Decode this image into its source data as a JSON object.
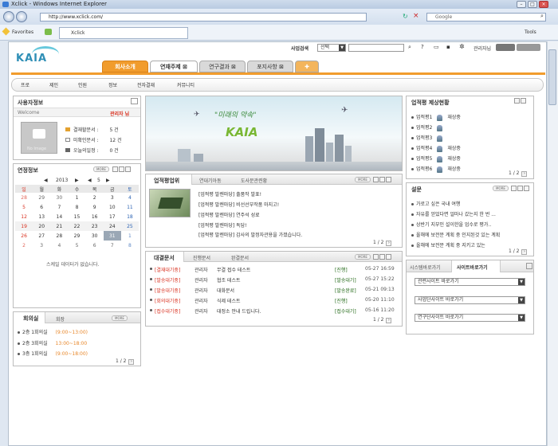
{
  "browser": {
    "window_title": "Xclick - Windows Internet Explorer",
    "address": "http://www.xclick.com/",
    "search_placeholder": "Google",
    "favorites_label": "Favorites",
    "tab_label": "Xclick",
    "tools_label": "Tools"
  },
  "header": {
    "logo": "KAIA",
    "search_label": "사업검색",
    "search_select": "선택",
    "user_label": "관리자님",
    "main_tabs": [
      "회사소개",
      "연재주제",
      "연구결과",
      "포지사항"
    ],
    "sub_menu": [
      "프로",
      "제인",
      "인원",
      "정보",
      "전자결재",
      "커뮤니티"
    ]
  },
  "user_panel": {
    "title": "사용자정보",
    "welcome": "Welcome",
    "user_name": "관리자 님",
    "no_image": "No Image",
    "stats": [
      {
        "label": "결재할문서 :",
        "value": "5 건"
      },
      {
        "label": "미확인문서 :",
        "value": "12 건"
      },
      {
        "label": "오늘의일정 :",
        "value": "0 건"
      }
    ]
  },
  "calendar": {
    "title": "연정정보",
    "more": "MORE",
    "year": "2013",
    "month": "5",
    "weekdays": [
      "일",
      "월",
      "화",
      "수",
      "목",
      "금",
      "토"
    ],
    "weeks": [
      [
        "28",
        "29",
        "30",
        "1",
        "2",
        "3",
        "4"
      ],
      [
        "5",
        "6",
        "7",
        "8",
        "9",
        "10",
        "11"
      ],
      [
        "12",
        "13",
        "14",
        "15",
        "16",
        "17",
        "18"
      ],
      [
        "19",
        "20",
        "21",
        "22",
        "23",
        "24",
        "25"
      ],
      [
        "26",
        "27",
        "28",
        "29",
        "30",
        "31",
        "1"
      ],
      [
        "2",
        "3",
        "4",
        "5",
        "6",
        "7",
        "8"
      ]
    ],
    "empty_message": "스케일 데이터가 없습니다."
  },
  "meeting": {
    "tabs": [
      "회의실",
      "회장"
    ],
    "more": "MORE",
    "rows": [
      {
        "room": "2층 1회의실",
        "time": "(9:00~13:00)"
      },
      {
        "room": "2층 3회의실",
        "time": "13:00~18:00"
      },
      {
        "room": "3층 1회의실",
        "time": "(9:00~18:00)"
      }
    ],
    "page": "1 / 2"
  },
  "banner": {
    "slogan": "\"미래의 약속\"",
    "brand": "KAIA"
  },
  "notice": {
    "tabs": [
      "업적평업위",
      "연대기아동",
      "도사문관련황"
    ],
    "more": "MORE",
    "items": [
      "[업적평 발렌마당] 출품작 발표!",
      "[업적평 발렌마당] 비선선부작품 마지고!",
      "[업적평 발렌마당] 연주석 성료",
      "[업적평 발렌마당] 독담!",
      "[업적평 발렌마당] 감사의 발정자관용을 가졌습니다."
    ],
    "page": "1 / 2"
  },
  "approval": {
    "tabs": [
      "대결문서",
      "진행문서",
      "완결문서"
    ],
    "more": "MORE",
    "rows": [
      {
        "tag": "[결재대기중]",
        "author": "관리자",
        "title": "무결 접수 테스트",
        "status": "[진행]",
        "date": "05-27 16:59"
      },
      {
        "tag": "[발송대기중]",
        "author": "관리자",
        "title": "협조 테스트",
        "status": "[발송대기]",
        "date": "05-27 15:22"
      },
      {
        "tag": "[발송대기중]",
        "author": "관리자",
        "title": "대화문서",
        "status": "[발송완료]",
        "date": "05-21 09:13"
      },
      {
        "tag": "[회의대기중]",
        "author": "관리자",
        "title": "식제 테스트",
        "status": "[진행]",
        "date": "05-20 11:10"
      },
      {
        "tag": "[접수대기중]",
        "author": "관리자",
        "title": "대정소 안내 드립니다.",
        "status": "[접수대기]",
        "date": "05-16 11:20"
      }
    ],
    "page": "1 / 2"
  },
  "status_panel": {
    "title": "업적평 제상현황",
    "rows": [
      {
        "label": "업적평1",
        "value": "재상중"
      },
      {
        "label": "업적평2",
        "value": ""
      },
      {
        "label": "업적평3",
        "value": ""
      },
      {
        "label": "업적평4",
        "value": "재상중"
      },
      {
        "label": "업적평5",
        "value": "재상중"
      },
      {
        "label": "업적평6",
        "value": "재상중"
      }
    ],
    "page": "1 / 2"
  },
  "survey": {
    "title": "설문",
    "more": "MORE",
    "items": [
      "가로고 싶은 국내 여행",
      "자유를 얻었다면 얼마나 갔는지 한 번 ...",
      "상반기 지부인 설이한을 업수로 평가..",
      "올해에 보전문 계획 중 인지된것 있는 계획",
      "올해에 보전문 계획 중 지키고 있는"
    ],
    "page": "1 / 2"
  },
  "shortcuts": {
    "tabs": [
      "시스템바로가기",
      "사이트바로가기"
    ],
    "selects": [
      "관련사이트 바로가기",
      "사업단사이트 바로가기",
      "연구단사이트 바로가기"
    ]
  },
  "colors": {
    "orange": "#f19c2d",
    "teal": "#2f8fb6",
    "red": "#d9301f",
    "blue": "#2b62b3",
    "green": "#2e7d1e",
    "dark_green": "#256b1a"
  }
}
